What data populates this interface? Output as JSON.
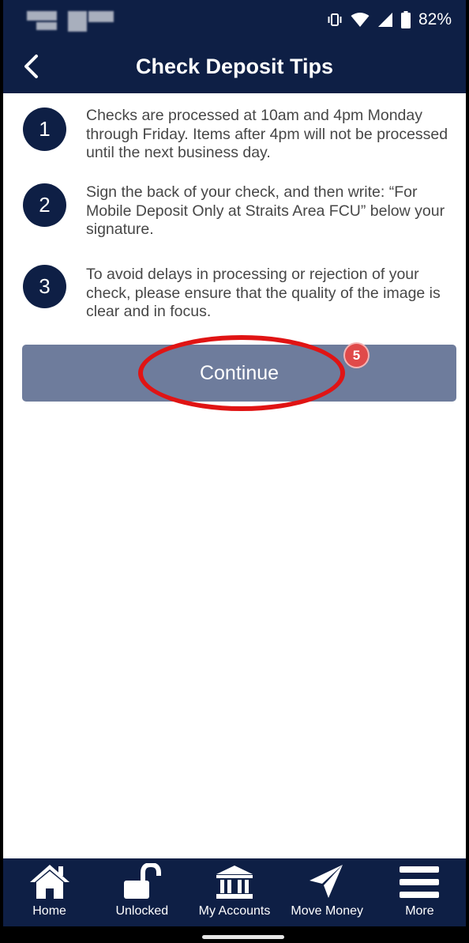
{
  "status_bar": {
    "battery": "82%",
    "icons": [
      "vibrate-icon",
      "wifi-icon",
      "signal-icon",
      "battery-icon"
    ]
  },
  "header": {
    "title": "Check Deposit Tips",
    "back_icon": "chevron-left-icon"
  },
  "tips": [
    {
      "number": "1",
      "text": "Checks are processed at 10am and 4pm Monday through Friday.  Items after 4pm will not be processed until the next business day."
    },
    {
      "number": "2",
      "text": "Sign the back of your check, and then write:  “For Mobile Deposit Only at Straits Area FCU” below your signature."
    },
    {
      "number": "3",
      "text": "To avoid delays in processing or rejection of your check, please ensure that the quality of the image is clear and in focus."
    }
  ],
  "continue_button": {
    "label": "Continue"
  },
  "annotation": {
    "step_badge": "5",
    "color": "#e01414"
  },
  "bottom_nav": [
    {
      "label": "Home",
      "icon": "home-icon"
    },
    {
      "label": "Unlocked",
      "icon": "unlocked-padlock-icon"
    },
    {
      "label": "My Accounts",
      "icon": "bank-icon"
    },
    {
      "label": "Move Money",
      "icon": "paper-plane-icon"
    },
    {
      "label": "More",
      "icon": "hamburger-menu-icon"
    }
  ],
  "colors": {
    "navy": "#0e1f45",
    "button": "#6e7c9c",
    "text": "#474747"
  }
}
